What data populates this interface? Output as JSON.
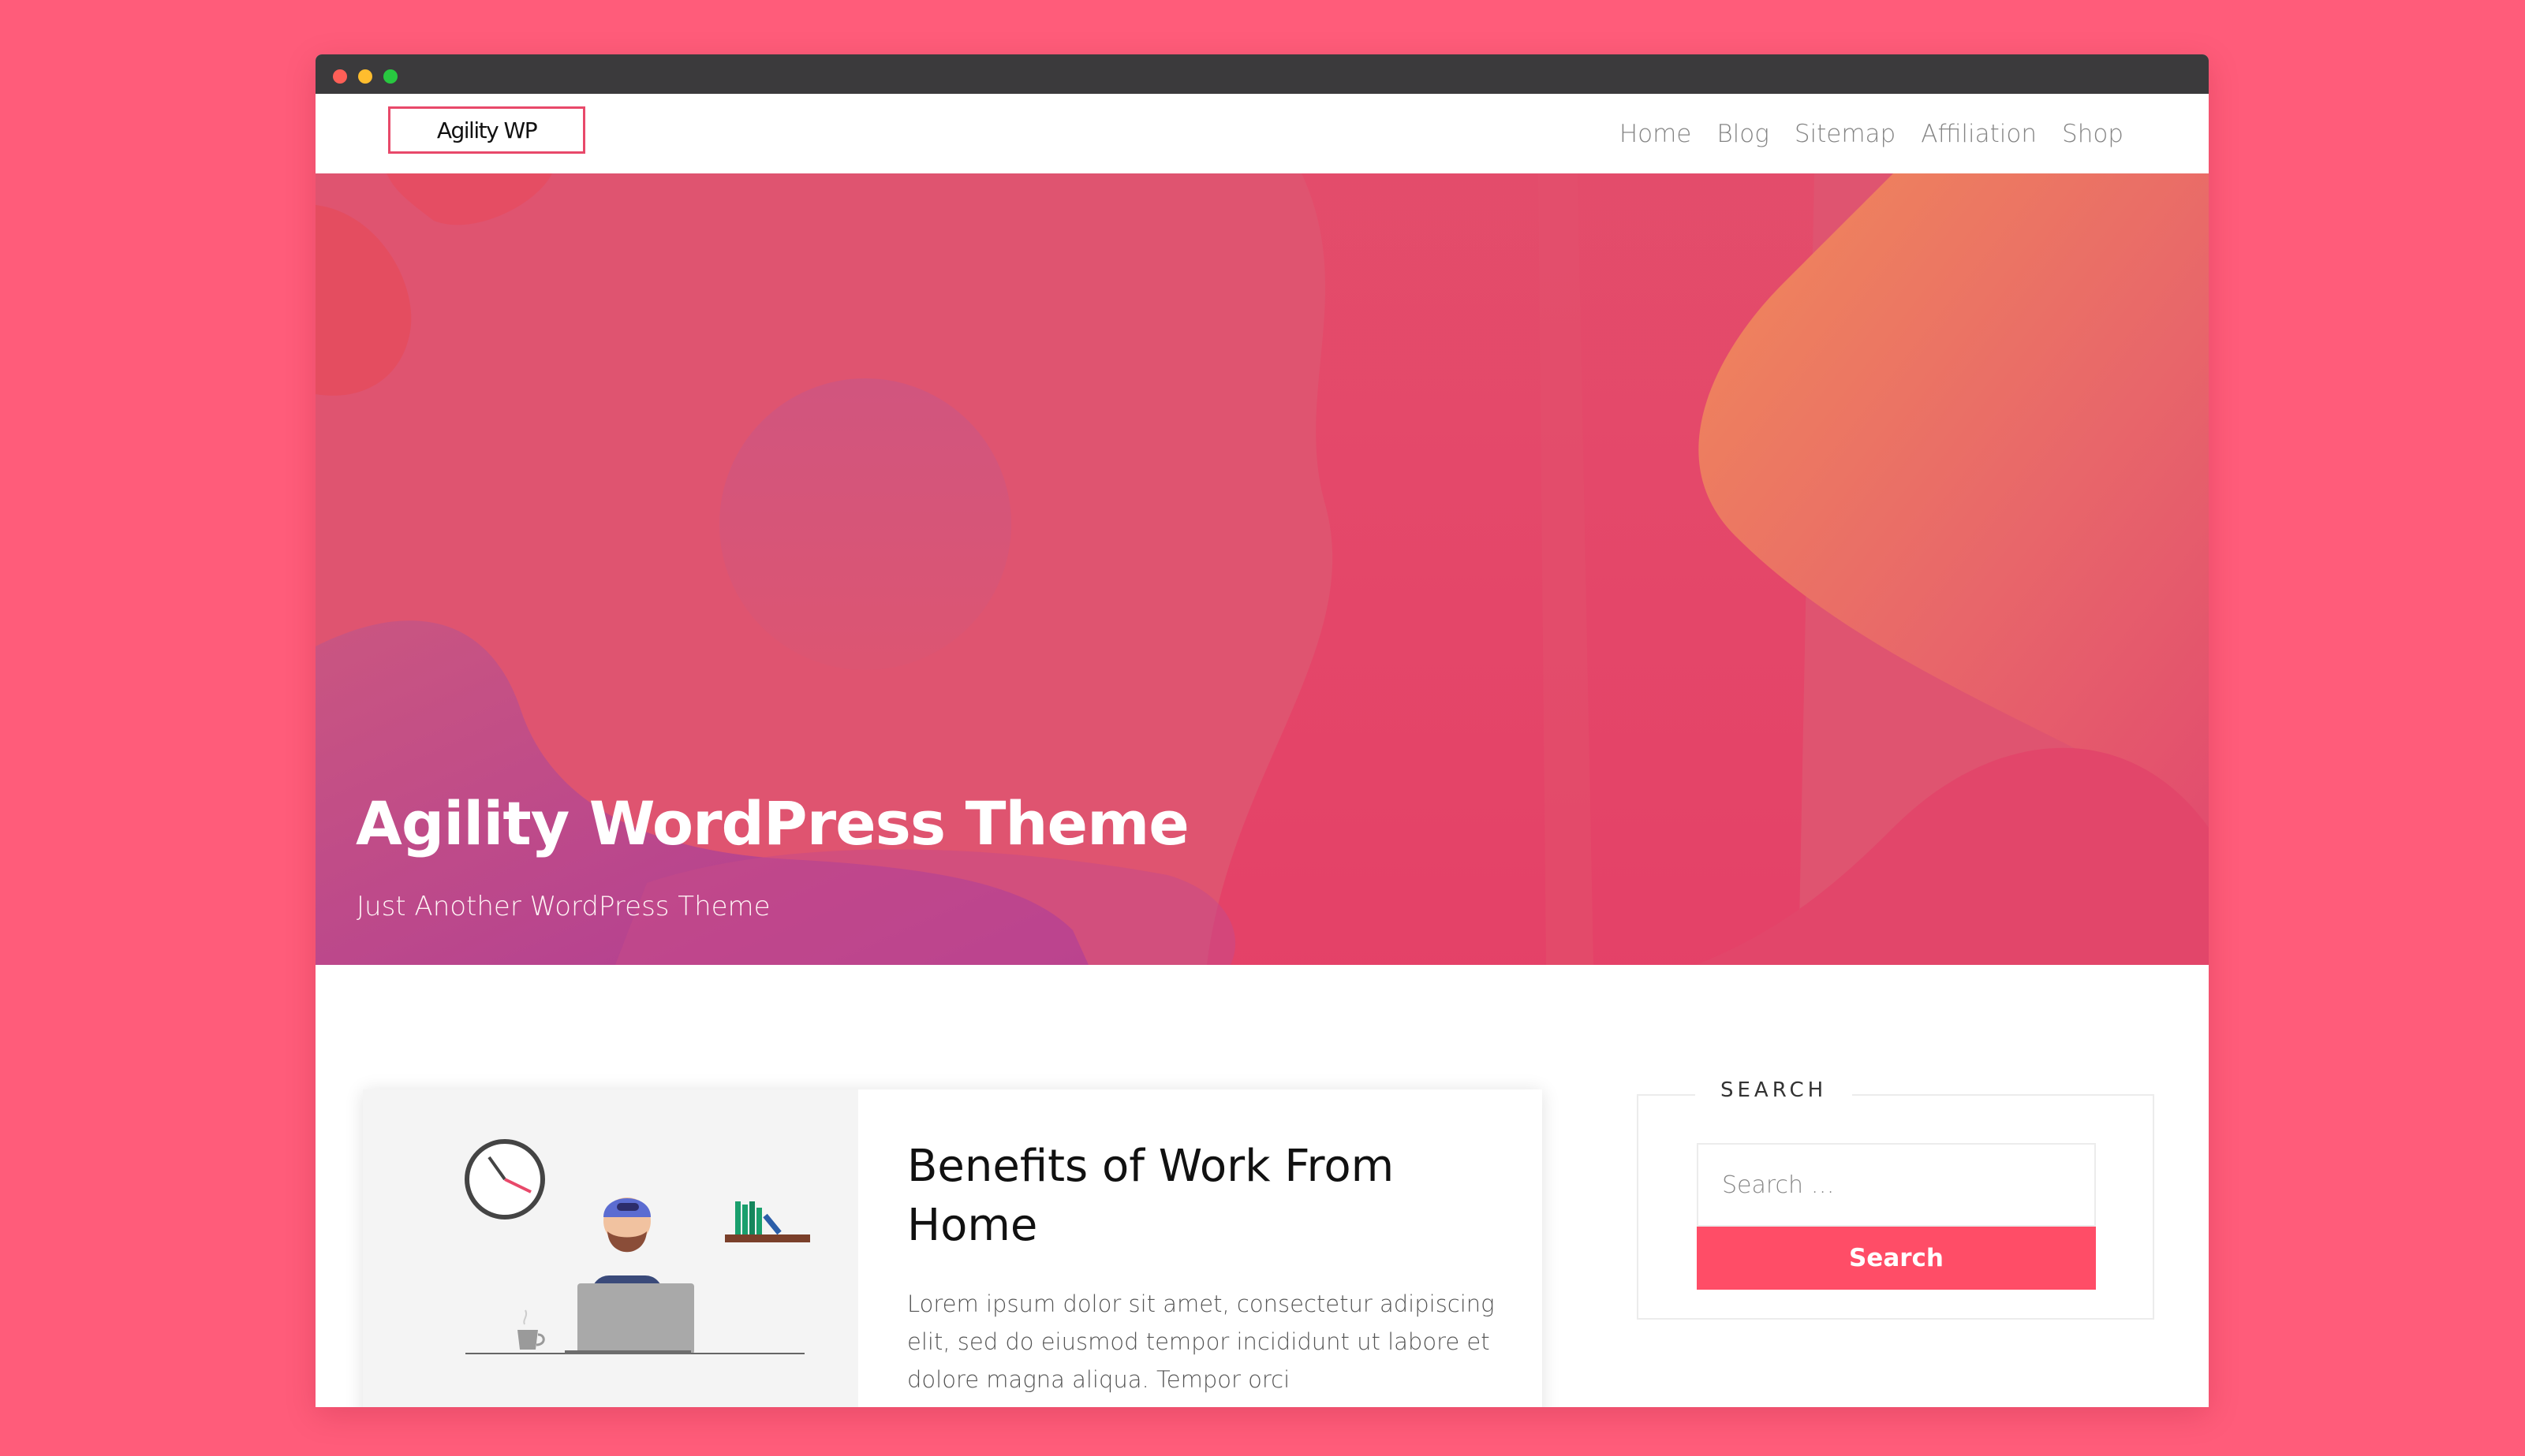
{
  "browser": {
    "window_controls": [
      "close",
      "minimize",
      "maximize"
    ]
  },
  "site": {
    "logo_text": "Agility WP",
    "nav": [
      {
        "label": "Home"
      },
      {
        "label": "Blog"
      },
      {
        "label": "Sitemap"
      },
      {
        "label": "Affiliation"
      },
      {
        "label": "Shop"
      }
    ]
  },
  "hero": {
    "title": "Agility WordPress Theme",
    "subtitle": "Just Another WordPress Theme"
  },
  "post": {
    "title": "Benefits of Work From Home",
    "excerpt": "Lorem ipsum dolor sit amet, consectetur adipiscing elit, sed do eiusmod tempor incididunt ut labore et dolore magna aliqua. Tempor orci"
  },
  "sidebar": {
    "search_widget": {
      "title": "SEARCH",
      "placeholder": "Search …",
      "button_label": "Search"
    }
  },
  "colors": {
    "page_background": "#ff5c7a",
    "accent": "#ff4d67",
    "logo_border": "#e8496a",
    "titlebar": "#3b3a3c"
  }
}
